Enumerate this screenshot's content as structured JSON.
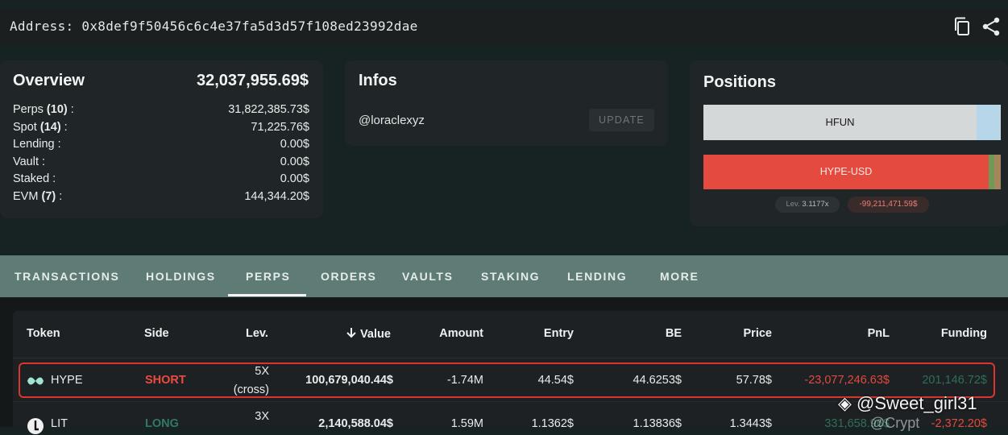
{
  "address": {
    "text": "Address: 0x8def9f50456c6c4e37fa5d3d57f108ed23992dae"
  },
  "icons": {
    "copy": "copy-icon",
    "share": "share-icon"
  },
  "overview": {
    "title": "Overview",
    "total": "32,037,955.69$",
    "rows": [
      {
        "label": "Perps ",
        "count": "(10)",
        "suffix": " :",
        "value": "31,822,385.73$"
      },
      {
        "label": "Spot ",
        "count": "(14)",
        "suffix": " :",
        "value": "71,225.76$"
      },
      {
        "label": "Lending :",
        "count": "",
        "suffix": "",
        "value": "0.00$"
      },
      {
        "label": "Vault :",
        "count": "",
        "suffix": "",
        "value": "0.00$"
      },
      {
        "label": "Staked :",
        "count": "",
        "suffix": "",
        "value": "0.00$"
      },
      {
        "label": "EVM ",
        "count": "(7)",
        "suffix": " :",
        "value": "144,344.20$"
      }
    ]
  },
  "infos": {
    "title": "Infos",
    "handle": "@loraclexyz",
    "update_label": "UPDATE"
  },
  "positions": {
    "title": "Positions",
    "bars": [
      {
        "label": "HFUN",
        "color": "#d5d8d8"
      },
      {
        "label": "HYPE-USD",
        "color": "#e44b3e"
      }
    ],
    "lev_label": "Lev.",
    "lev_value": "3.1177x",
    "pnl": "-99,211,471.59$"
  },
  "tabs": [
    "TRANSACTIONS",
    "HOLDINGS",
    "PERPS",
    "ORDERS",
    "VAULTS",
    "STAKING",
    "LENDING",
    "MORE"
  ],
  "active_tab": "PERPS",
  "table": {
    "headers": [
      "Token",
      "Side",
      "Lev.",
      "Value",
      "Amount",
      "Entry",
      "BE",
      "Price",
      "PnL",
      "Funding"
    ],
    "sort_icon": "arrow-down-icon",
    "rows": [
      {
        "token": "HYPE",
        "side": "SHORT",
        "lev": "5X",
        "lev_mode": "(cross)",
        "value": "100,679,040.44$",
        "amount": "-1.74M",
        "entry": "44.54$",
        "be": "44.6253$",
        "price": "57.78$",
        "pnl": "-23,077,246.63$",
        "funding": "201,146.72$"
      },
      {
        "token": "LIT",
        "side": "LONG",
        "lev": "3X",
        "lev_mode": "",
        "value": "2,140,588.04$",
        "amount": "1.59M",
        "entry": "1.1362$",
        "be": "1.13836$",
        "price": "1.3443$",
        "pnl": "331,658.96$",
        "funding": "-2,372.20$"
      }
    ]
  },
  "watermark": {
    "text": "@Sweet_girl31",
    "ghost": "@Crypt"
  },
  "colors": {
    "accent_red": "#e44b3e",
    "tab_bar": "#5e7b76",
    "long_green": "#2f7a63"
  }
}
